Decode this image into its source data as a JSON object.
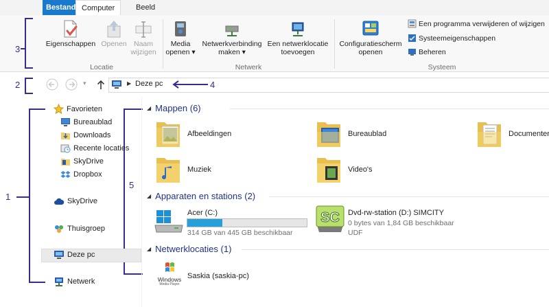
{
  "tabs": {
    "file": "Bestand",
    "computer": "Computer",
    "view": "Beeld"
  },
  "ribbon": {
    "locatie": {
      "label": "Locatie",
      "properties": "Eigenschappen",
      "open": "Openen",
      "rename_1": "Naam",
      "rename_2": "wijzigen"
    },
    "netwerk": {
      "label": "Netwerk",
      "media_1": "Media",
      "media_2": "openen",
      "map_1": "Netwerkverbinding",
      "map_2": "maken",
      "add_1": "Een netwerklocatie",
      "add_2": "toevoegen"
    },
    "systeem": {
      "label": "Systeem",
      "control_1": "Configuratiescherm",
      "control_2": "openen",
      "uninstall": "Een programma verwijderen of wijzigen",
      "sysprops": "Systeemeigenschappen",
      "manage": "Beheren"
    }
  },
  "address": {
    "crumb": "Deze pc"
  },
  "annotations": {
    "n1": "1",
    "n2": "2",
    "n3": "3",
    "n4": "4",
    "n5": "5"
  },
  "nav": {
    "favorites": "Favorieten",
    "fav_items": [
      "Bureaublad",
      "Downloads",
      "Recente locaties",
      "SkyDrive",
      "Dropbox"
    ],
    "skydrive": "SkyDrive",
    "homegroup": "Thuisgroep",
    "thispc": "Deze pc",
    "network": "Netwerk"
  },
  "content": {
    "folders_header": "Mappen (6)",
    "folders": [
      "Afbeeldingen",
      "Bureaublad",
      "Documenten",
      "Muziek",
      "Video's"
    ],
    "devices_header": "Apparaten en stations (2)",
    "drive_c": {
      "name": "Acer (C:)",
      "free": "314 GB van 445 GB beschikbaar",
      "used_fraction": 0.294
    },
    "dvd": {
      "name": "Dvd-rw-station (D:) SIMCITY",
      "free": "0 bytes van 1,84 GB beschikbaar",
      "fs": "UDF"
    },
    "network_header": "Netwerklocaties (1)",
    "network_item": "Saskia (saskia-pc)",
    "wmp_logo_1": "Windows",
    "wmp_logo_2": "Media Player"
  },
  "colors": {
    "accent": "#1979ca",
    "annotation": "#3c2a8a",
    "section": "#1e3287",
    "drive_bar": "#26a0da"
  }
}
